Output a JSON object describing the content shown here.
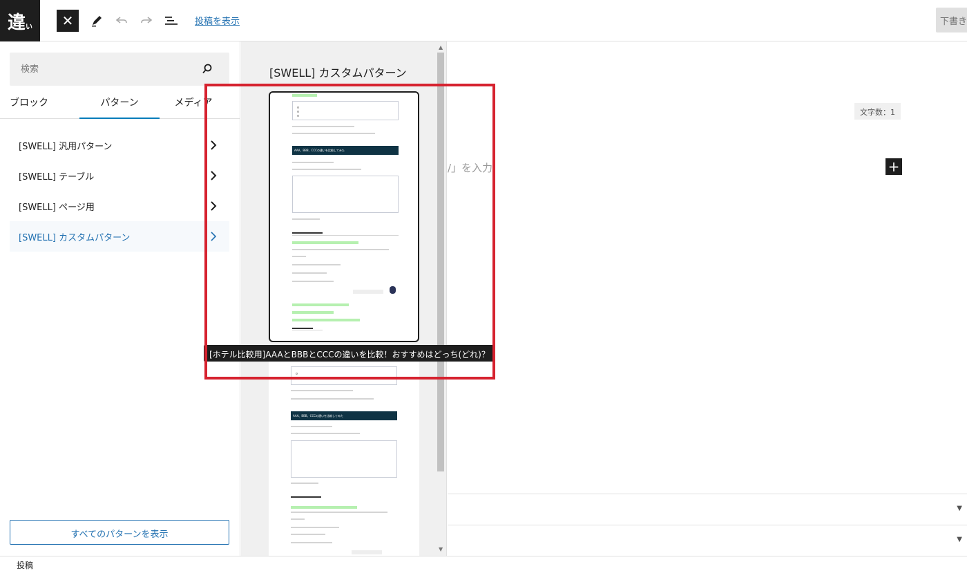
{
  "header": {
    "site_logo_text": "違",
    "site_logo_small": "い",
    "view_post": "投稿を表示",
    "save_draft": "下書き"
  },
  "sidebar": {
    "search_placeholder": "検索",
    "tabs": [
      {
        "label": "ブロック"
      },
      {
        "label": "パターン",
        "active": true
      },
      {
        "label": "メディア"
      }
    ],
    "categories": [
      {
        "label": "[SWELL] 汎用パターン"
      },
      {
        "label": "[SWELL] テーブル"
      },
      {
        "label": "[SWELL] ページ用"
      },
      {
        "label": "[SWELL] カスタムパターン",
        "selected": true
      }
    ],
    "all_patterns_button": "すべてのパターンを表示"
  },
  "preview": {
    "title": "[SWELL] カスタムパターン",
    "thumb_heading": "AAA、BBB、CCCの違いを比較してみた",
    "tooltip": "[ホテル比較用]AAAとBBBとCCCの違いを比較！おすすめはどっち(どれ)？"
  },
  "editor": {
    "word_count": "文字数：1",
    "placeholder_fragment": "/」を入力",
    "add_block_symbol": "+"
  },
  "statusbar": {
    "label": "投稿"
  },
  "colors": {
    "accent": "#2271b1",
    "highlight_frame": "#d6222f",
    "dark": "#1e1e1e"
  }
}
